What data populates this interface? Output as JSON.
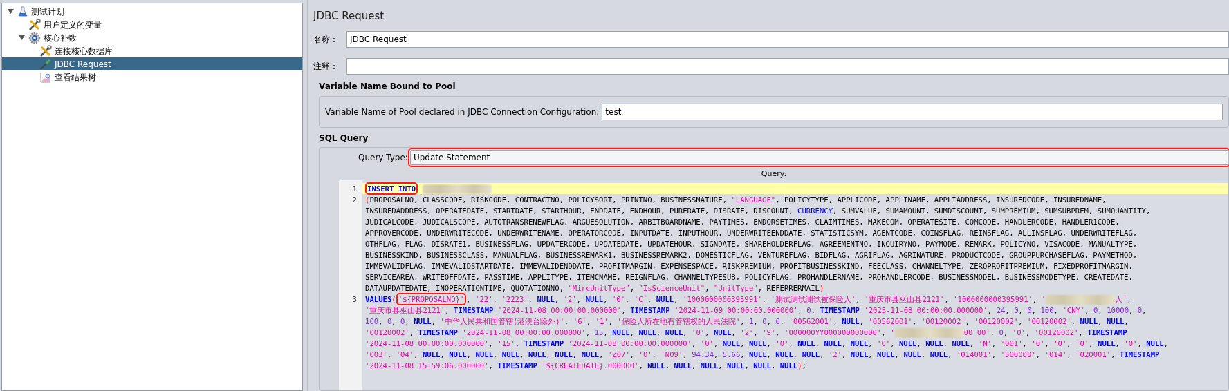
{
  "tree": [
    {
      "label": "测试计划",
      "kind": "plan",
      "expanded": true,
      "selected": false,
      "children": [
        {
          "label": "用户定义的变量",
          "kind": "config",
          "selected": false
        },
        {
          "label": "核心补数",
          "kind": "threads",
          "expanded": true,
          "selected": false,
          "children": [
            {
              "label": "连接核心数据库",
              "kind": "config",
              "selected": false
            },
            {
              "label": "JDBC Request",
              "kind": "sampler",
              "selected": true
            },
            {
              "label": "查看结果树",
              "kind": "listener",
              "selected": false
            }
          ]
        }
      ]
    }
  ],
  "panel": {
    "title": "JDBC Request",
    "name": {
      "label": "名称：",
      "value": "JDBC Request"
    },
    "comments": {
      "label": "注释："
    },
    "pool": {
      "heading": "Variable Name Bound to Pool",
      "label": "Variable Name of Pool declared in JDBC Connection Configuration:",
      "value": "test"
    },
    "sql": {
      "heading": "SQL Query",
      "query_type": {
        "label": "Query Type:",
        "value": "Update Statement",
        "highlighted": true
      },
      "query_label": "Query:",
      "lines": [
        {
          "number": "1",
          "current": true,
          "wraps": [
            {
              "segments": [
                {
                  "kind": "keyword",
                  "text": "INSERT INTO",
                  "highlighted": true
                },
                {
                  "kind": "space"
                },
                {
                  "kind": "redacted"
                }
              ]
            }
          ]
        },
        {
          "number": "2",
          "current": false,
          "wraps": [
            {
              "segments": [
                {
                  "kind": "paren",
                  "text": "("
                },
                {
                  "kind": "plain",
                  "text": "PROPOSALNO, CLASSCODE, RISKCODE, CONTRACTNO, POLICYSORT, PRINTNO, BUSINESSNATURE, "
                },
                {
                  "kind": "string",
                  "text": "\"LANGUAGE\""
                },
                {
                  "kind": "plain",
                  "text": ", POLICYTYPE, APPLICODE, APPLINAME, APPLIADDRESS, INSUREDCODE, INSUREDNAME,"
                }
              ]
            },
            {
              "segments": [
                {
                  "kind": "plain",
                  "text": "INSUREDADDRESS, OPERATEDATE, STARTDATE, STARTHOUR, ENDDATE, ENDHOUR, PURERATE, DISRATE, DISCOUNT, "
                },
                {
                  "kind": "ident",
                  "text": "CURRENCY"
                },
                {
                  "kind": "plain",
                  "text": ", SUMVALUE, SUMAMOUNT, SUMDISCOUNT, SUMPREMIUM, SUMSUBPREM, SUMQUANTITY,"
                }
              ]
            },
            {
              "segments": [
                {
                  "kind": "plain",
                  "text": "JUDICALCODE, JUDICALSCOPE, AUTOTRANSRENEWFLAG, ARGUESOLUTION, ARBITBOARDNAME, PAYTIMES, ENDORSETIMES, CLAIMTIMES, MAKECOM, OPERATESITE, COMCODE, HANDLERCODE, HANDLER1CODE,"
                }
              ]
            },
            {
              "segments": [
                {
                  "kind": "plain",
                  "text": "APPROVERCODE, UNDERWRITECODE, UNDERWRITENAME, OPERATORCODE, INPUTDATE, INPUTHOUR, UNDERWRITEENDDATE, STATISTICSYM, AGENTCODE, COINSFLAG, REINSFLAG, ALLINSFLAG, UNDERWRITEFLAG,"
                }
              ]
            },
            {
              "segments": [
                {
                  "kind": "plain",
                  "text": "OTHFLAG, FLAG, DISRATE1, BUSINESSFLAG, UPDATERCODE, UPDATEDATE, UPDATEHOUR, SIGNDATE, SHAREHOLDERFLAG, AGREEMENTNO, INQUIRYNO, PAYMODE, REMARK, POLICYNO, VISACODE, MANUALTYPE,"
                }
              ]
            },
            {
              "segments": [
                {
                  "kind": "plain",
                  "text": "BUSINESSKIND, BUSINESSCLASS, MANUALFLAG, BUSINESSREMARK1, BUSINESSREMARK2, DOMESTICFLAG, VENTUREFLAG, BIDFLAG, AGRIFLAG, AGRINATURE, PRODUCTCODE, GROUPPURCHASEFLAG, PAYMETHOD,"
                }
              ]
            },
            {
              "segments": [
                {
                  "kind": "plain",
                  "text": "IMMEVALIDFLAG, IMMEVALIDSTARTDATE, IMMEVALIDENDDATE, PROFITMARGIN, EXPENSESPACE, RISKPREMIUM, PROFITBUSINESSKIND, FEECLASS, CHANNELTYPE, ZEROPROFITPREMIUM, FIXEDPROFITMARGIN,"
                }
              ]
            },
            {
              "segments": [
                {
                  "kind": "plain",
                  "text": "SERVICEAREA, WRITEOFFDATE, PASSTIME, APPLITYPE, ITEMCNAME, REIGNFLAG, CHANNELTYPESUB, POLICYFLAG, PROHANDLERNAME, PROHANDLERCODE, BUSINESSMODEL, BUSINESSMODETYPE, CREATEDATE,"
                }
              ]
            },
            {
              "segments": [
                {
                  "kind": "plain",
                  "text": "DATAUPDATEDATE, INOPERATIONTIME, QUOTATIONNO, "
                },
                {
                  "kind": "string",
                  "text": "\"MircUnitType\""
                },
                {
                  "kind": "plain",
                  "text": ", "
                },
                {
                  "kind": "string",
                  "text": "\"IsScienceUnit\""
                },
                {
                  "kind": "plain",
                  "text": ", "
                },
                {
                  "kind": "string",
                  "text": "\"UnitType\""
                },
                {
                  "kind": "plain",
                  "text": ", REFERRERMAIL"
                },
                {
                  "kind": "paren",
                  "text": ")"
                }
              ]
            }
          ]
        },
        {
          "number": "3",
          "current": false,
          "wraps": [
            {
              "segments": [
                {
                  "kind": "keyword",
                  "text": "VALUES"
                },
                {
                  "kind": "paren",
                  "text": "("
                },
                {
                  "kind": "string",
                  "text": "'${PROPOSALNO}'",
                  "highlighted": true
                },
                {
                  "kind": "plain",
                  "text": ", "
                },
                {
                  "kind": "string",
                  "text": "'22'"
                },
                {
                  "kind": "plain",
                  "text": ", "
                },
                {
                  "kind": "string",
                  "text": "'2223'"
                },
                {
                  "kind": "plain",
                  "text": ", "
                },
                {
                  "kind": "keyword",
                  "text": "NULL"
                },
                {
                  "kind": "plain",
                  "text": ", "
                },
                {
                  "kind": "string",
                  "text": "'2'"
                },
                {
                  "kind": "plain",
                  "text": ", "
                },
                {
                  "kind": "keyword",
                  "text": "NULL"
                },
                {
                  "kind": "plain",
                  "text": ", "
                },
                {
                  "kind": "string",
                  "text": "'0'"
                },
                {
                  "kind": "plain",
                  "text": ", "
                },
                {
                  "kind": "string",
                  "text": "'C'"
                },
                {
                  "kind": "plain",
                  "text": ", "
                },
                {
                  "kind": "keyword",
                  "text": "NULL"
                },
                {
                  "kind": "plain",
                  "text": ", "
                },
                {
                  "kind": "string",
                  "text": "'1000000000395991'"
                },
                {
                  "kind": "plain",
                  "text": ", "
                },
                {
                  "kind": "string",
                  "text": "'测试测试测试被保险人'"
                },
                {
                  "kind": "plain",
                  "text": ", "
                },
                {
                  "kind": "string",
                  "text": "'重庆市县巫山县2121'"
                },
                {
                  "kind": "plain",
                  "text": ", "
                },
                {
                  "kind": "string",
                  "text": "'1000000000395991'"
                },
                {
                  "kind": "plain",
                  "text": ", "
                },
                {
                  "kind": "string",
                  "text": "'"
                },
                {
                  "kind": "redacted"
                },
                {
                  "kind": "string",
                  "text": "人'"
                },
                {
                  "kind": "plain",
                  "text": ","
                }
              ]
            },
            {
              "segments": [
                {
                  "kind": "string",
                  "text": "'重庆市县巫山县2121'"
                },
                {
                  "kind": "plain",
                  "text": ", "
                },
                {
                  "kind": "keyword",
                  "text": "TIMESTAMP"
                },
                {
                  "kind": "space"
                },
                {
                  "kind": "string",
                  "text": "'2024-11-08 00:00:00.000000'"
                },
                {
                  "kind": "plain",
                  "text": ", "
                },
                {
                  "kind": "keyword",
                  "text": "TIMESTAMP"
                },
                {
                  "kind": "space"
                },
                {
                  "kind": "string",
                  "text": "'2024-11-09 00:00:00.000000'"
                },
                {
                  "kind": "plain",
                  "text": ", "
                },
                {
                  "kind": "number",
                  "text": "0"
                },
                {
                  "kind": "plain",
                  "text": ", "
                },
                {
                  "kind": "keyword",
                  "text": "TIMESTAMP"
                },
                {
                  "kind": "space"
                },
                {
                  "kind": "string",
                  "text": "'2025-11-08 00:00:00.000000'"
                },
                {
                  "kind": "plain",
                  "text": ", "
                },
                {
                  "kind": "number",
                  "text": "24"
                },
                {
                  "kind": "plain",
                  "text": ", "
                },
                {
                  "kind": "number",
                  "text": "0"
                },
                {
                  "kind": "plain",
                  "text": ", "
                },
                {
                  "kind": "number",
                  "text": "0"
                },
                {
                  "kind": "plain",
                  "text": ", "
                },
                {
                  "kind": "number",
                  "text": "100"
                },
                {
                  "kind": "plain",
                  "text": ", "
                },
                {
                  "kind": "string",
                  "text": "'CNY'"
                },
                {
                  "kind": "plain",
                  "text": ", "
                },
                {
                  "kind": "number",
                  "text": "0"
                },
                {
                  "kind": "plain",
                  "text": ", "
                },
                {
                  "kind": "number",
                  "text": "10000"
                },
                {
                  "kind": "plain",
                  "text": ", "
                },
                {
                  "kind": "number",
                  "text": "0"
                },
                {
                  "kind": "plain",
                  "text": ","
                }
              ]
            },
            {
              "segments": [
                {
                  "kind": "number",
                  "text": "100"
                },
                {
                  "kind": "plain",
                  "text": ", "
                },
                {
                  "kind": "number",
                  "text": "0"
                },
                {
                  "kind": "plain",
                  "text": ", "
                },
                {
                  "kind": "number",
                  "text": "0"
                },
                {
                  "kind": "plain",
                  "text": ", "
                },
                {
                  "kind": "keyword",
                  "text": "NULL"
                },
                {
                  "kind": "plain",
                  "text": ", "
                },
                {
                  "kind": "string",
                  "text": "'中华人民共和国管辖(港澳台除外)'"
                },
                {
                  "kind": "plain",
                  "text": ", "
                },
                {
                  "kind": "string",
                  "text": "'6'"
                },
                {
                  "kind": "plain",
                  "text": ", "
                },
                {
                  "kind": "string",
                  "text": "'1'"
                },
                {
                  "kind": "plain",
                  "text": ", "
                },
                {
                  "kind": "string",
                  "text": "'保险人所在地有管辖权的人民法院'"
                },
                {
                  "kind": "plain",
                  "text": ", "
                },
                {
                  "kind": "number",
                  "text": "1"
                },
                {
                  "kind": "plain",
                  "text": ", "
                },
                {
                  "kind": "number",
                  "text": "0"
                },
                {
                  "kind": "plain",
                  "text": ", "
                },
                {
                  "kind": "number",
                  "text": "0"
                },
                {
                  "kind": "plain",
                  "text": ", "
                },
                {
                  "kind": "string",
                  "text": "'00562001'"
                },
                {
                  "kind": "plain",
                  "text": ", "
                },
                {
                  "kind": "keyword",
                  "text": "NULL"
                },
                {
                  "kind": "plain",
                  "text": ", "
                },
                {
                  "kind": "string",
                  "text": "'00562001'"
                },
                {
                  "kind": "plain",
                  "text": ", "
                },
                {
                  "kind": "string",
                  "text": "'00120002'"
                },
                {
                  "kind": "plain",
                  "text": ", "
                },
                {
                  "kind": "string",
                  "text": "'00120002'"
                },
                {
                  "kind": "plain",
                  "text": ", "
                },
                {
                  "kind": "string",
                  "text": "'00120002'"
                },
                {
                  "kind": "plain",
                  "text": ", "
                },
                {
                  "kind": "keyword",
                  "text": "NULL"
                },
                {
                  "kind": "plain",
                  "text": ", "
                },
                {
                  "kind": "keyword",
                  "text": "NULL"
                },
                {
                  "kind": "plain",
                  "text": ","
                }
              ]
            },
            {
              "segments": [
                {
                  "kind": "string",
                  "text": "'00120002'"
                },
                {
                  "kind": "plain",
                  "text": ", "
                },
                {
                  "kind": "keyword",
                  "text": "TIMESTAMP"
                },
                {
                  "kind": "space"
                },
                {
                  "kind": "string",
                  "text": "'2024-11-08 00:00:00.000000'"
                },
                {
                  "kind": "plain",
                  "text": ", "
                },
                {
                  "kind": "number",
                  "text": "15"
                },
                {
                  "kind": "plain",
                  "text": ", "
                },
                {
                  "kind": "keyword",
                  "text": "NULL"
                },
                {
                  "kind": "plain",
                  "text": ", "
                },
                {
                  "kind": "keyword",
                  "text": "NULL"
                },
                {
                  "kind": "plain",
                  "text": ", "
                },
                {
                  "kind": "keyword",
                  "text": "NULL"
                },
                {
                  "kind": "plain",
                  "text": ", "
                },
                {
                  "kind": "string",
                  "text": "'0'"
                },
                {
                  "kind": "plain",
                  "text": ", "
                },
                {
                  "kind": "keyword",
                  "text": "NULL"
                },
                {
                  "kind": "plain",
                  "text": ", "
                },
                {
                  "kind": "string",
                  "text": "'2'"
                },
                {
                  "kind": "plain",
                  "text": ", "
                },
                {
                  "kind": "string",
                  "text": "'9'"
                },
                {
                  "kind": "plain",
                  "text": ", "
                },
                {
                  "kind": "string",
                  "text": "'000000YY000000000000'"
                },
                {
                  "kind": "plain",
                  "text": ", "
                },
                {
                  "kind": "string",
                  "text": "'"
                },
                {
                  "kind": "redacted"
                },
                {
                  "kind": "string",
                  "text": "00 00'"
                },
                {
                  "kind": "plain",
                  "text": ", "
                },
                {
                  "kind": "number",
                  "text": "0"
                },
                {
                  "kind": "plain",
                  "text": ", "
                },
                {
                  "kind": "string",
                  "text": "'0'"
                },
                {
                  "kind": "plain",
                  "text": ", "
                },
                {
                  "kind": "string",
                  "text": "'00120002'"
                },
                {
                  "kind": "plain",
                  "text": ", "
                },
                {
                  "kind": "keyword",
                  "text": "TIMESTAMP"
                }
              ]
            },
            {
              "segments": [
                {
                  "kind": "string",
                  "text": "'2024-11-08 00:00:00.000000'"
                },
                {
                  "kind": "plain",
                  "text": ", "
                },
                {
                  "kind": "string",
                  "text": "'15'"
                },
                {
                  "kind": "plain",
                  "text": ", "
                },
                {
                  "kind": "keyword",
                  "text": "TIMESTAMP"
                },
                {
                  "kind": "space"
                },
                {
                  "kind": "string",
                  "text": "'2024-11-08 00:00:00.000000'"
                },
                {
                  "kind": "plain",
                  "text": ", "
                },
                {
                  "kind": "string",
                  "text": "'0'"
                },
                {
                  "kind": "plain",
                  "text": ", "
                },
                {
                  "kind": "keyword",
                  "text": "NULL"
                },
                {
                  "kind": "plain",
                  "text": ", "
                },
                {
                  "kind": "keyword",
                  "text": "NULL"
                },
                {
                  "kind": "plain",
                  "text": ", "
                },
                {
                  "kind": "string",
                  "text": "'0'"
                },
                {
                  "kind": "plain",
                  "text": ", "
                },
                {
                  "kind": "keyword",
                  "text": "NULL"
                },
                {
                  "kind": "plain",
                  "text": ", "
                },
                {
                  "kind": "keyword",
                  "text": "NULL"
                },
                {
                  "kind": "plain",
                  "text": ", "
                },
                {
                  "kind": "keyword",
                  "text": "NULL"
                },
                {
                  "kind": "plain",
                  "text": ", "
                },
                {
                  "kind": "string",
                  "text": "'0'"
                },
                {
                  "kind": "plain",
                  "text": ", "
                },
                {
                  "kind": "keyword",
                  "text": "NULL"
                },
                {
                  "kind": "plain",
                  "text": ", "
                },
                {
                  "kind": "keyword",
                  "text": "NULL"
                },
                {
                  "kind": "plain",
                  "text": ", "
                },
                {
                  "kind": "keyword",
                  "text": "NULL"
                },
                {
                  "kind": "plain",
                  "text": ", "
                },
                {
                  "kind": "string",
                  "text": "'N'"
                },
                {
                  "kind": "plain",
                  "text": ", "
                },
                {
                  "kind": "string",
                  "text": "'001'"
                },
                {
                  "kind": "plain",
                  "text": ", "
                },
                {
                  "kind": "string",
                  "text": "'0'"
                },
                {
                  "kind": "plain",
                  "text": ", "
                },
                {
                  "kind": "string",
                  "text": "'0'"
                },
                {
                  "kind": "plain",
                  "text": ", "
                },
                {
                  "kind": "string",
                  "text": "'0'"
                },
                {
                  "kind": "plain",
                  "text": ", "
                },
                {
                  "kind": "keyword",
                  "text": "NULL"
                },
                {
                  "kind": "plain",
                  "text": ", "
                },
                {
                  "kind": "string",
                  "text": "'0'"
                },
                {
                  "kind": "plain",
                  "text": ", "
                },
                {
                  "kind": "keyword",
                  "text": "NULL"
                },
                {
                  "kind": "plain",
                  "text": ","
                }
              ]
            },
            {
              "segments": [
                {
                  "kind": "string",
                  "text": "'003'"
                },
                {
                  "kind": "plain",
                  "text": ", "
                },
                {
                  "kind": "string",
                  "text": "'04'"
                },
                {
                  "kind": "plain",
                  "text": ", "
                },
                {
                  "kind": "keyword",
                  "text": "NULL"
                },
                {
                  "kind": "plain",
                  "text": ", "
                },
                {
                  "kind": "keyword",
                  "text": "NULL"
                },
                {
                  "kind": "plain",
                  "text": ", "
                },
                {
                  "kind": "keyword",
                  "text": "NULL"
                },
                {
                  "kind": "plain",
                  "text": ", "
                },
                {
                  "kind": "keyword",
                  "text": "NULL"
                },
                {
                  "kind": "plain",
                  "text": ", "
                },
                {
                  "kind": "keyword",
                  "text": "NULL"
                },
                {
                  "kind": "plain",
                  "text": ", "
                },
                {
                  "kind": "keyword",
                  "text": "NULL"
                },
                {
                  "kind": "plain",
                  "text": ", "
                },
                {
                  "kind": "keyword",
                  "text": "NULL"
                },
                {
                  "kind": "plain",
                  "text": ", "
                },
                {
                  "kind": "string",
                  "text": "'Z07'"
                },
                {
                  "kind": "plain",
                  "text": ", "
                },
                {
                  "kind": "string",
                  "text": "'0'"
                },
                {
                  "kind": "plain",
                  "text": ", "
                },
                {
                  "kind": "string",
                  "text": "'N09'"
                },
                {
                  "kind": "plain",
                  "text": ", "
                },
                {
                  "kind": "number",
                  "text": "94.34"
                },
                {
                  "kind": "plain",
                  "text": ", "
                },
                {
                  "kind": "number",
                  "text": "5.66"
                },
                {
                  "kind": "plain",
                  "text": ", "
                },
                {
                  "kind": "keyword",
                  "text": "NULL"
                },
                {
                  "kind": "plain",
                  "text": ", "
                },
                {
                  "kind": "keyword",
                  "text": "NULL"
                },
                {
                  "kind": "plain",
                  "text": ", "
                },
                {
                  "kind": "keyword",
                  "text": "NULL"
                },
                {
                  "kind": "plain",
                  "text": ", "
                },
                {
                  "kind": "string",
                  "text": "'2'"
                },
                {
                  "kind": "plain",
                  "text": ", "
                },
                {
                  "kind": "keyword",
                  "text": "NULL"
                },
                {
                  "kind": "plain",
                  "text": ", "
                },
                {
                  "kind": "keyword",
                  "text": "NULL"
                },
                {
                  "kind": "plain",
                  "text": ", "
                },
                {
                  "kind": "keyword",
                  "text": "NULL"
                },
                {
                  "kind": "plain",
                  "text": ", "
                },
                {
                  "kind": "keyword",
                  "text": "NULL"
                },
                {
                  "kind": "plain",
                  "text": ", "
                },
                {
                  "kind": "string",
                  "text": "'014001'"
                },
                {
                  "kind": "plain",
                  "text": ", "
                },
                {
                  "kind": "string",
                  "text": "'500000'"
                },
                {
                  "kind": "plain",
                  "text": ", "
                },
                {
                  "kind": "string",
                  "text": "'014'"
                },
                {
                  "kind": "plain",
                  "text": ", "
                },
                {
                  "kind": "string",
                  "text": "'020001'"
                },
                {
                  "kind": "plain",
                  "text": ", "
                },
                {
                  "kind": "keyword",
                  "text": "TIMESTAMP"
                }
              ]
            },
            {
              "segments": [
                {
                  "kind": "string",
                  "text": "'2024-11-08 15:59:06.000000'"
                },
                {
                  "kind": "plain",
                  "text": ", "
                },
                {
                  "kind": "keyword",
                  "text": "TIMESTAMP"
                },
                {
                  "kind": "space"
                },
                {
                  "kind": "string",
                  "text": "'${CREATEDATE}.000000'"
                },
                {
                  "kind": "plain",
                  "text": ", "
                },
                {
                  "kind": "keyword",
                  "text": "NULL"
                },
                {
                  "kind": "plain",
                  "text": ", "
                },
                {
                  "kind": "keyword",
                  "text": "NULL"
                },
                {
                  "kind": "plain",
                  "text": ", "
                },
                {
                  "kind": "keyword",
                  "text": "NULL"
                },
                {
                  "kind": "plain",
                  "text": ", "
                },
                {
                  "kind": "keyword",
                  "text": "NULL"
                },
                {
                  "kind": "plain",
                  "text": ", "
                },
                {
                  "kind": "keyword",
                  "text": "NULL"
                },
                {
                  "kind": "plain",
                  "text": ", "
                },
                {
                  "kind": "keyword",
                  "text": "NULL"
                },
                {
                  "kind": "paren",
                  "text": ")"
                },
                {
                  "kind": "plain",
                  "text": ";"
                }
              ]
            }
          ]
        }
      ]
    }
  }
}
